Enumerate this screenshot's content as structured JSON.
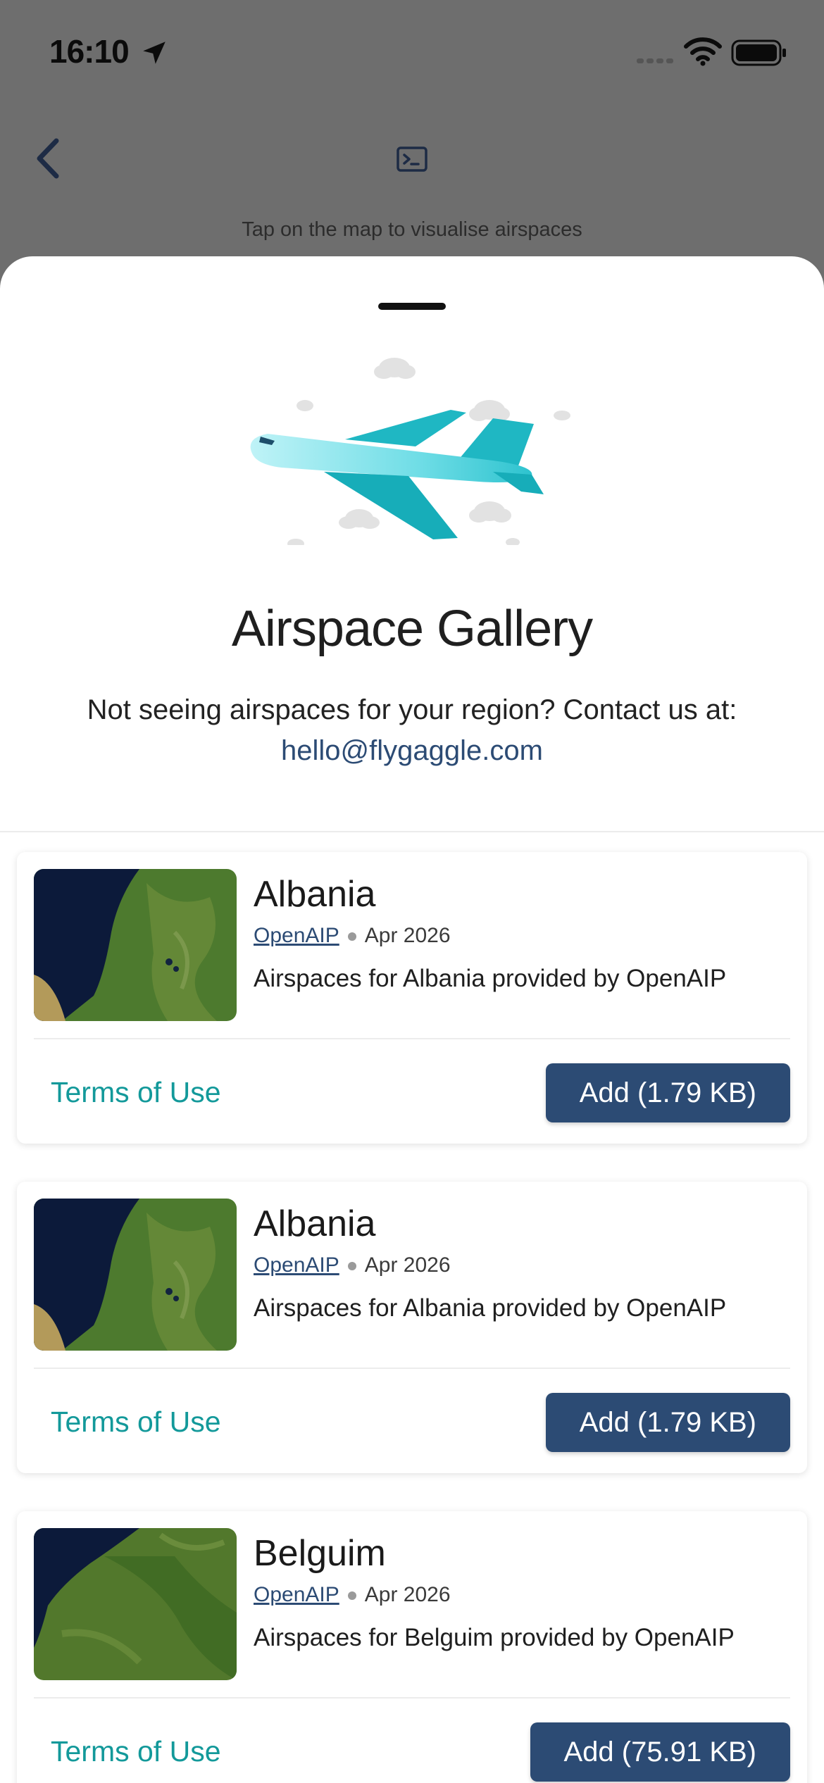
{
  "status_bar": {
    "time": "16:10"
  },
  "background_screen": {
    "hint": "Tap on the map to visualise airspaces"
  },
  "sheet": {
    "title": "Airspace Gallery",
    "subtitle": "Not seeing airspaces for your region? Contact us at:",
    "email": "hello@flygaggle.com"
  },
  "items": [
    {
      "title": "Albania",
      "source": "OpenAIP",
      "date": "Apr 2026",
      "description": "Airspaces for Albania provided by OpenAIP",
      "terms_label": "Terms of Use",
      "add_label": "Add (1.79 KB)"
    },
    {
      "title": "Albania",
      "source": "OpenAIP",
      "date": "Apr 2026",
      "description": "Airspaces for Albania provided by OpenAIP",
      "terms_label": "Terms of Use",
      "add_label": "Add (1.79 KB)"
    },
    {
      "title": "Belguim",
      "source": "OpenAIP",
      "date": "Apr 2026",
      "description": "Airspaces for Belguim provided by OpenAIP",
      "terms_label": "Terms of Use",
      "add_label": "Add (75.91 KB)"
    }
  ],
  "colors": {
    "accent_navy": "#2c4b74",
    "link_teal": "#13999a",
    "overlay_gray": "#6e6e6e"
  }
}
